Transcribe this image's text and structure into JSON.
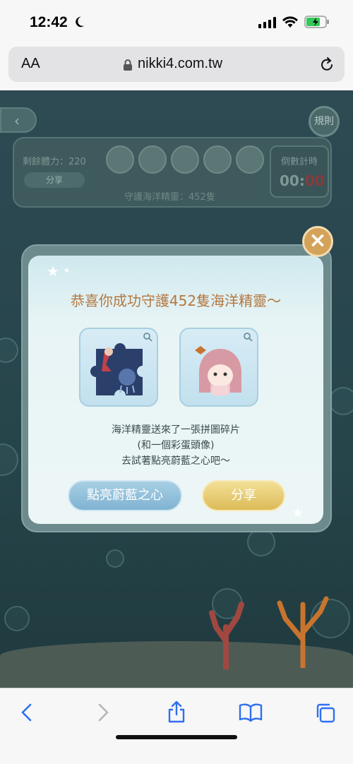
{
  "status": {
    "time": "12:42"
  },
  "browser": {
    "aa_label": "AA",
    "url": "nikki4.com.tw"
  },
  "game": {
    "rules_label": "規則",
    "remaining_label": "剩餘體力：220",
    "share_small": "分享",
    "countdown_label": "倒數計時",
    "countdown_value_a": "00:",
    "countdown_value_b": "00",
    "guard_text": "守護海洋精靈：452隻"
  },
  "modal": {
    "title": "恭喜你成功守護452隻海洋精靈～",
    "line1": "海洋精靈送來了一張拼圖碎片",
    "line2": "(和一個彩蛋頭像)",
    "line3": "去試著點亮蔚藍之心吧～",
    "btn_light": "點亮蔚藍之心",
    "btn_share": "分享",
    "close": "×"
  },
  "colors": {
    "accent_gold": "#d4a35a",
    "title_brown": "#b4773f",
    "button_blue": "#7fb3d2",
    "button_yellow": "#dcbb58"
  },
  "icons": [
    "moon-icon",
    "signal-icon",
    "wifi-icon",
    "battery-icon",
    "lock-icon",
    "reload-icon",
    "back-icon",
    "forward-icon",
    "share-icon",
    "bookmarks-icon",
    "tabs-icon",
    "zoom-icon",
    "close-icon"
  ]
}
